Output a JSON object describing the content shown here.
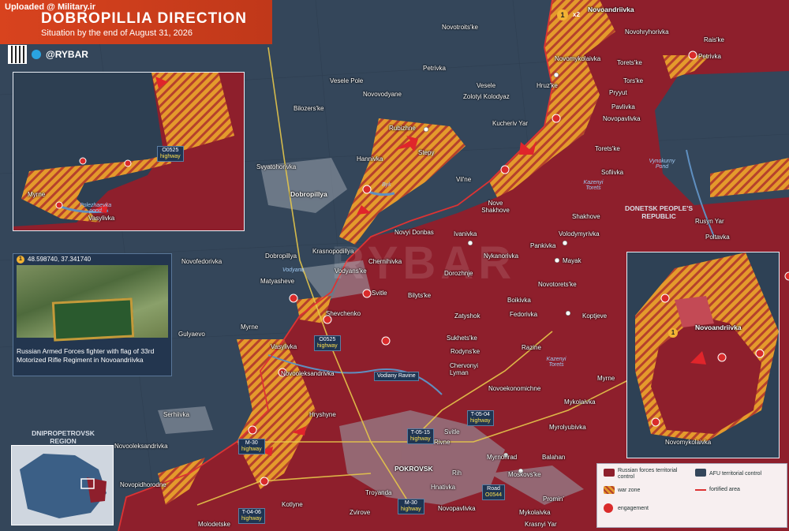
{
  "header": {
    "uploaded": "Uploaded @ Military.ir",
    "title": "DOBROPILLIA DIRECTION",
    "subtitle": "Situation by the end of August 31, 2026",
    "brand": "@RYBAR"
  },
  "colors": {
    "russian_control": "#8e1f2c",
    "afu_control": "#34465a",
    "war_zone": "#e49a2c",
    "accent": "#d8431e"
  },
  "places": [
    {
      "name": "Novotroits'ke"
    },
    {
      "name": "Petrivka"
    },
    {
      "name": "Vesele Pole"
    },
    {
      "name": "Novovodyane"
    },
    {
      "name": "Bilozers'ke"
    },
    {
      "name": "Zolotyi Kolodyaz"
    },
    {
      "name": "Vesele"
    },
    {
      "name": "Hruz'ke"
    },
    {
      "name": "Novoandriivka"
    },
    {
      "name": "Novohryhorivka"
    },
    {
      "name": "Rais'ke"
    },
    {
      "name": "Petrivka"
    },
    {
      "name": "Novomykolaivka"
    },
    {
      "name": "Torets'ke"
    },
    {
      "name": "Tors'ke"
    },
    {
      "name": "Pryyut"
    },
    {
      "name": "Pavlivka"
    },
    {
      "name": "Novopavlivka"
    },
    {
      "name": "Kucheriv Yar"
    },
    {
      "name": "Rubizhne"
    },
    {
      "name": "Stepy"
    },
    {
      "name": "Hannivka"
    },
    {
      "name": "Svyatohorivka"
    },
    {
      "name": "Dobropillya"
    },
    {
      "name": "Vil'ne"
    },
    {
      "name": "Nove Shakhove"
    },
    {
      "name": "Torets'ke"
    },
    {
      "name": "Sofiivka"
    },
    {
      "name": "Shakhove"
    },
    {
      "name": "Rusyn Yar"
    },
    {
      "name": "Poltavka"
    },
    {
      "name": "Novyi Donbas"
    },
    {
      "name": "Ivanivka"
    },
    {
      "name": "Volodymyrivka"
    },
    {
      "name": "Pankivka"
    },
    {
      "name": "Mayak"
    },
    {
      "name": "Nykanorivka"
    },
    {
      "name": "Krasnopodillya"
    },
    {
      "name": "Chernihivka"
    },
    {
      "name": "Dobropillya"
    },
    {
      "name": "Novofedorivka"
    },
    {
      "name": "Vodyans'ke"
    },
    {
      "name": "Matyasheve"
    },
    {
      "name": "Svitle"
    },
    {
      "name": "Dorozhnje"
    },
    {
      "name": "Bilyts'ke"
    },
    {
      "name": "Novotorets'ke"
    },
    {
      "name": "Boikivka"
    },
    {
      "name": "Fedorivka"
    },
    {
      "name": "Koptjeve"
    },
    {
      "name": "Myrne"
    },
    {
      "name": "Vasylivka"
    },
    {
      "name": "Shevchenko"
    },
    {
      "name": "Zatyshok"
    },
    {
      "name": "Sukhets'ke"
    },
    {
      "name": "Rodyns'ke"
    },
    {
      "name": "Razine"
    },
    {
      "name": "Chervonyi Lyman"
    },
    {
      "name": "Gulyaevo"
    },
    {
      "name": "Novooleksandrivka"
    },
    {
      "name": "Novoekonomichne"
    },
    {
      "name": "Myrne"
    },
    {
      "name": "Serhiivka"
    },
    {
      "name": "Hryshyne"
    },
    {
      "name": "Mykolaivka"
    },
    {
      "name": "Svitle"
    },
    {
      "name": "Myrolyubivka"
    },
    {
      "name": "Novooleksandrivka"
    },
    {
      "name": "Rivne"
    },
    {
      "name": "Myrnohrad"
    },
    {
      "name": "Balahan"
    },
    {
      "name": "POKROVSK"
    },
    {
      "name": "Rih"
    },
    {
      "name": "Moskovs'ke"
    },
    {
      "name": "Troyanda"
    },
    {
      "name": "Hnativka"
    },
    {
      "name": "Novopidhorodne"
    },
    {
      "name": "Kotlyne"
    },
    {
      "name": "Zvirove"
    },
    {
      "name": "Novopavlivka"
    },
    {
      "name": "Promin'"
    },
    {
      "name": "Molodetske"
    },
    {
      "name": "Mykolaivka"
    },
    {
      "name": "Krasnyi Yar"
    }
  ],
  "roads": [
    {
      "id": "O0525",
      "type": "highway"
    },
    {
      "id": "T-05-15",
      "type": "highway"
    },
    {
      "id": "T-05-04",
      "type": "highway"
    },
    {
      "id": "M-30",
      "type": "highway"
    },
    {
      "id": "M-30",
      "type": "highway"
    },
    {
      "id": "Road",
      "type": "O0544"
    },
    {
      "id": "T-04-06",
      "type": "highway"
    }
  ],
  "rivers": [
    "Byk",
    "Vodyana",
    "Kazenyi Torets",
    "Kazenyi Torets",
    "Vodiany Ravine"
  ],
  "water": [
    "Vynokurny Pond",
    "Polezhaevka pond"
  ],
  "regions": [
    "DONETSK PEOPLE'S REPUBLIC",
    "DNIPROPETROVSK REGION"
  ],
  "inset1": {
    "labels": [
      "Myrne",
      "Vasylivka"
    ],
    "road": {
      "id": "O0525",
      "type": "highway"
    },
    "pond": "Polezhaevka pond"
  },
  "inset2": {
    "labels": [
      "Novoandriivka",
      "Novomykolaivka"
    ],
    "badge": "1"
  },
  "photo": {
    "badge": "1",
    "coords": "48.598740, 37.341740",
    "caption": "Russian Armed Forces fighter with flag of 33rd Motorized Rifle Regiment in Novoandriivka"
  },
  "top_badge": {
    "count": "x2",
    "badge": "1"
  },
  "legend": {
    "russian": "Russian forces territorial control",
    "afu": "AFU territorial control",
    "war_zone": "war zone",
    "fortified": "fortified area",
    "engagement": "engagement"
  }
}
